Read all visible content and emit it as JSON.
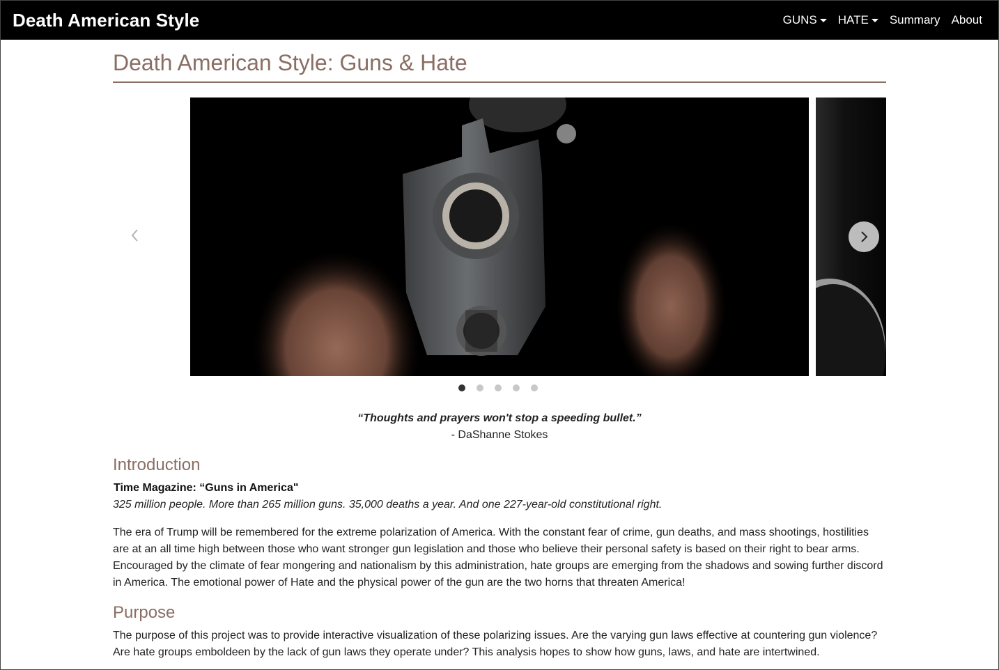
{
  "navbar": {
    "brand": "Death American Style",
    "items": [
      {
        "label": "GUNS",
        "dropdown": true
      },
      {
        "label": "HATE",
        "dropdown": true
      },
      {
        "label": "Summary",
        "dropdown": false
      },
      {
        "label": "About",
        "dropdown": false
      }
    ]
  },
  "page": {
    "title": "Death American Style: Guns & Hate"
  },
  "carousel": {
    "slide_count": 5,
    "active_index": 0,
    "prev_icon": "chevron-left-icon",
    "next_icon": "chevron-right-icon"
  },
  "quote": {
    "text": "“Thoughts and prayers won't stop a speeding bullet.”",
    "author": "- DaShanne Stokes"
  },
  "introduction": {
    "heading": "Introduction",
    "source_title": "Time Magazine: “Guns in America\"",
    "source_subtitle": "325 million people. More than 265 million guns. 35,000 deaths a year. And one 227-year-old constitutional right.",
    "body": "The era of Trump will be remembered for the extreme polarization of America. With the constant fear of crime, gun deaths, and mass shootings, hostilities are at an all time high between those who want stronger gun legislation and those who believe their personal safety is based on their right to bear arms. Encouraged by the climate of fear mongering and nationalism by this administration, hate groups are emerging from the shadows and sowing further discord in America. The emotional power of Hate and the physical power of the gun are the two horns that threaten America!"
  },
  "purpose": {
    "heading": "Purpose",
    "body": "The purpose of this project was to provide interactive visualization of these polarizing issues. Are the varying gun laws effective at countering gun violence? Are hate groups emboldeen by the lack of gun laws they operate under? This analysis hopes to show how guns, laws, and hate are intertwined."
  },
  "colors": {
    "navbar_bg": "#000000",
    "accent": "#8a6e63"
  }
}
